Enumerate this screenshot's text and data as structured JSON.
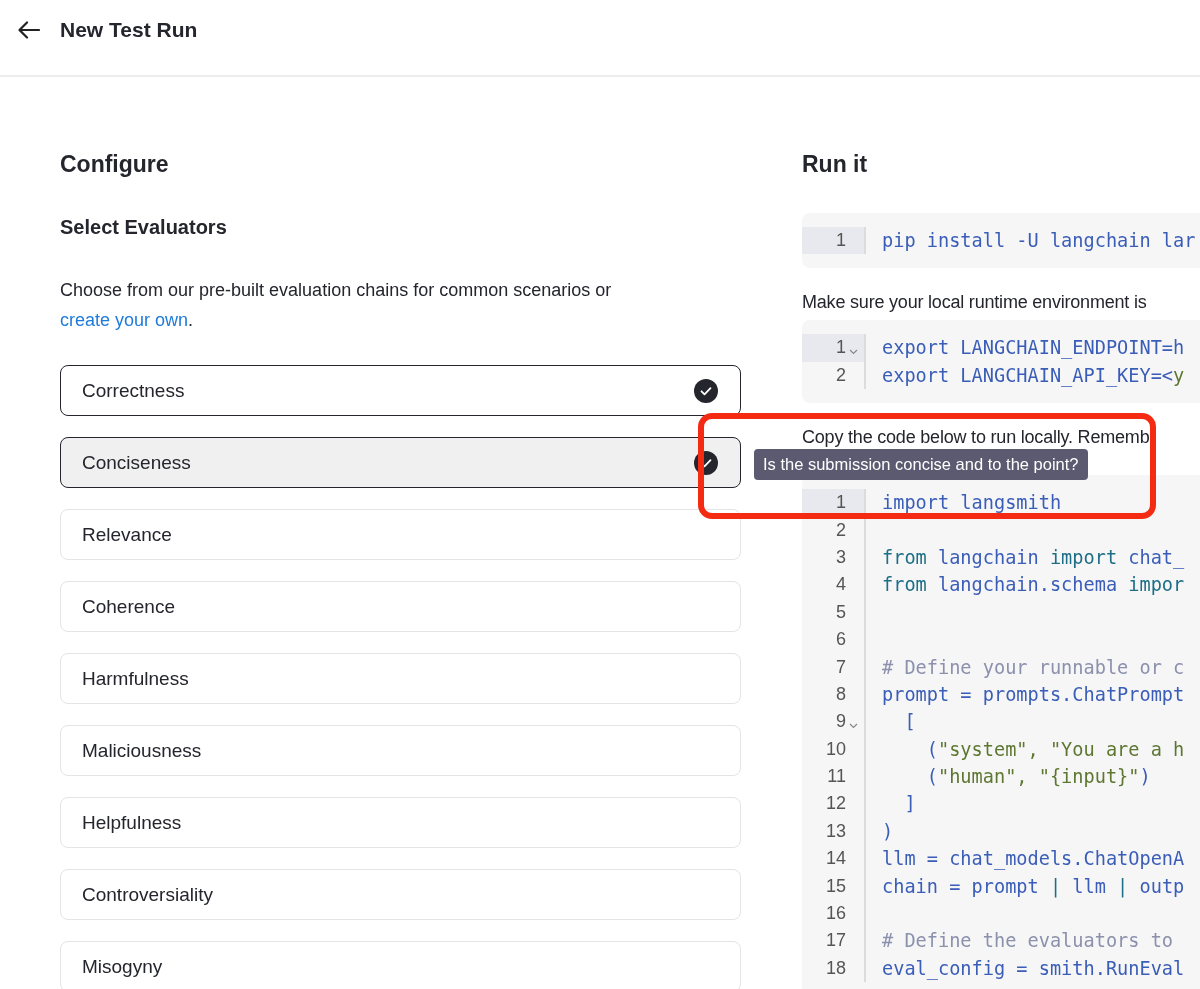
{
  "header": {
    "title": "New Test Run"
  },
  "configure": {
    "heading": "Configure",
    "subheading": "Select Evaluators",
    "intro": "Choose from our pre-built evaluation chains for common scenarios or",
    "link": "create your own",
    "after_link": ".",
    "evaluators": [
      {
        "label": "Correctness",
        "checked": true,
        "hovered": false
      },
      {
        "label": "Conciseness",
        "checked": true,
        "hovered": true
      },
      {
        "label": "Relevance",
        "checked": false,
        "hovered": false
      },
      {
        "label": "Coherence",
        "checked": false,
        "hovered": false
      },
      {
        "label": "Harmfulness",
        "checked": false,
        "hovered": false
      },
      {
        "label": "Maliciousness",
        "checked": false,
        "hovered": false
      },
      {
        "label": "Helpfulness",
        "checked": false,
        "hovered": false
      },
      {
        "label": "Controversiality",
        "checked": false,
        "hovered": false
      },
      {
        "label": "Misogyny",
        "checked": false,
        "hovered": false
      }
    ]
  },
  "run": {
    "heading": "Run it",
    "sections": [
      {
        "kind": "code",
        "lines": [
          {
            "number": "1",
            "active": true,
            "foldable": false,
            "tokens": [
              {
                "text": "pip install -U langchain lar",
                "kind": "name"
              }
            ]
          }
        ]
      },
      {
        "kind": "text",
        "text": "Make sure your local runtime environment is"
      },
      {
        "kind": "code",
        "lines": [
          {
            "number": "1",
            "active": true,
            "foldable": true,
            "tokens": [
              {
                "text": "export LANGCHAIN_ENDPOINT=h",
                "kind": "name"
              }
            ]
          },
          {
            "number": "2",
            "active": false,
            "foldable": false,
            "tokens": [
              {
                "text": "export LANGCHAIN_API_KEY=<",
                "kind": "name"
              },
              {
                "text": "y",
                "kind": "str"
              }
            ]
          }
        ]
      },
      {
        "kind": "text",
        "text": "Copy the code below to run locally. Rememb"
      },
      {
        "kind": "code",
        "lines": [
          {
            "number": "1",
            "active": true,
            "foldable": false,
            "tokens": [
              {
                "text": "import langsmith",
                "kind": "name"
              }
            ]
          },
          {
            "number": "2",
            "active": false,
            "foldable": false
          },
          {
            "number": "3",
            "active": false,
            "foldable": false,
            "tokens": [
              {
                "text": "from",
                "kind": "kw"
              },
              {
                "text": " langchain ",
                "kind": "name"
              },
              {
                "text": "import",
                "kind": "kw"
              },
              {
                "text": " chat_",
                "kind": "name"
              }
            ]
          },
          {
            "number": "4",
            "active": false,
            "foldable": false,
            "tokens": [
              {
                "text": "from",
                "kind": "kw"
              },
              {
                "text": " langchain.schema ",
                "kind": "name"
              },
              {
                "text": "impor",
                "kind": "kw"
              }
            ]
          },
          {
            "number": "5",
            "active": false,
            "foldable": false
          },
          {
            "number": "6",
            "active": false,
            "foldable": false
          },
          {
            "number": "7",
            "active": false,
            "foldable": false,
            "tokens": [
              {
                "text": "# Define your runnable or c",
                "kind": "comment"
              }
            ]
          },
          {
            "number": "8",
            "active": false,
            "foldable": false,
            "tokens": [
              {
                "text": "prompt = prompts.ChatPrompt",
                "kind": "name"
              }
            ]
          },
          {
            "number": "9",
            "active": false,
            "foldable": true,
            "tokens": [
              {
                "text": "  [",
                "kind": "name"
              }
            ]
          },
          {
            "number": "10",
            "active": false,
            "foldable": false,
            "tokens": [
              {
                "text": "    (",
                "kind": "name"
              },
              {
                "text": "\"system\", \"You are a h",
                "kind": "str"
              }
            ]
          },
          {
            "number": "11",
            "active": false,
            "foldable": false,
            "tokens": [
              {
                "text": "    (",
                "kind": "name"
              },
              {
                "text": "\"human\", \"{input}\"",
                "kind": "str"
              },
              {
                "text": ")",
                "kind": "name"
              }
            ]
          },
          {
            "number": "12",
            "active": false,
            "foldable": false,
            "tokens": [
              {
                "text": "  ]",
                "kind": "name"
              }
            ]
          },
          {
            "number": "13",
            "active": false,
            "foldable": false,
            "tokens": [
              {
                "text": ")",
                "kind": "name"
              }
            ]
          },
          {
            "number": "14",
            "active": false,
            "foldable": false,
            "tokens": [
              {
                "text": "llm = chat_models.ChatOpenA",
                "kind": "name"
              }
            ]
          },
          {
            "number": "15",
            "active": false,
            "foldable": false,
            "tokens": [
              {
                "text": "chain = prompt ",
                "kind": "name"
              },
              {
                "text": "|",
                "kind": "kw"
              },
              {
                "text": " llm ",
                "kind": "name"
              },
              {
                "text": "|",
                "kind": "kw"
              },
              {
                "text": " outp",
                "kind": "name"
              }
            ]
          },
          {
            "number": "16",
            "active": false,
            "foldable": false
          },
          {
            "number": "17",
            "active": false,
            "foldable": false,
            "tokens": [
              {
                "text": "# Define the evaluators to",
                "kind": "comment"
              }
            ]
          },
          {
            "number": "18",
            "active": false,
            "foldable": false,
            "tokens": [
              {
                "text": "eval_config = smith.RunEval",
                "kind": "name"
              }
            ]
          }
        ]
      }
    ]
  },
  "tooltip": {
    "text": "Is the submission concise and to the point?"
  },
  "annotation": {
    "kind": "frame"
  }
}
